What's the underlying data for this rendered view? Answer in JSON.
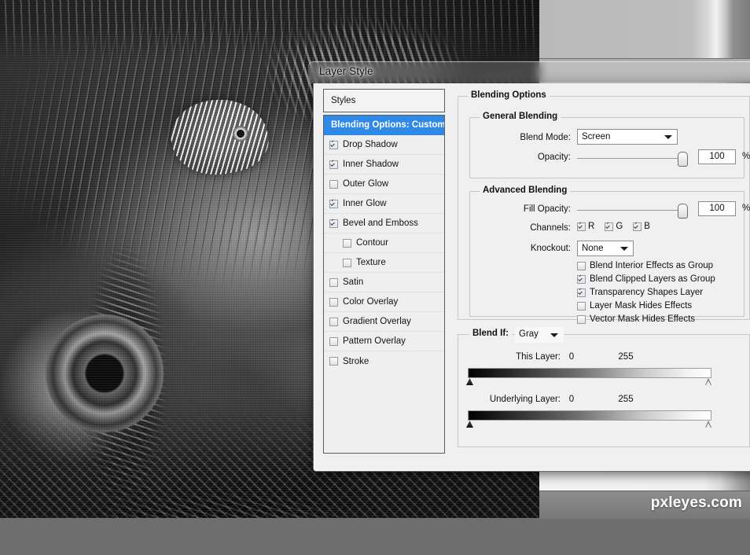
{
  "window": {
    "title": "Layer Style"
  },
  "styles_panel": {
    "header": "Styles",
    "items": [
      {
        "label": "Blending Options: Custom",
        "selected": true,
        "checkbox": null,
        "sub": false
      },
      {
        "label": "Drop Shadow",
        "selected": false,
        "checkbox": true,
        "sub": false
      },
      {
        "label": "Inner Shadow",
        "selected": false,
        "checkbox": true,
        "sub": false
      },
      {
        "label": "Outer Glow",
        "selected": false,
        "checkbox": false,
        "sub": false
      },
      {
        "label": "Inner Glow",
        "selected": false,
        "checkbox": true,
        "sub": false
      },
      {
        "label": "Bevel and Emboss",
        "selected": false,
        "checkbox": true,
        "sub": false
      },
      {
        "label": "Contour",
        "selected": false,
        "checkbox": false,
        "sub": true
      },
      {
        "label": "Texture",
        "selected": false,
        "checkbox": false,
        "sub": true
      },
      {
        "label": "Satin",
        "selected": false,
        "checkbox": false,
        "sub": false
      },
      {
        "label": "Color Overlay",
        "selected": false,
        "checkbox": false,
        "sub": false
      },
      {
        "label": "Gradient Overlay",
        "selected": false,
        "checkbox": false,
        "sub": false
      },
      {
        "label": "Pattern Overlay",
        "selected": false,
        "checkbox": false,
        "sub": false
      },
      {
        "label": "Stroke",
        "selected": false,
        "checkbox": false,
        "sub": false
      }
    ]
  },
  "blending_options": {
    "group_label": "Blending Options",
    "general": {
      "group_label": "General Blending",
      "blend_mode_label": "Blend Mode:",
      "blend_mode_value": "Screen",
      "opacity_label": "Opacity:",
      "opacity_value": "100",
      "opacity_unit": "%"
    },
    "advanced": {
      "group_label": "Advanced Blending",
      "fill_opacity_label": "Fill Opacity:",
      "fill_opacity_value": "100",
      "fill_opacity_unit": "%",
      "channels_label": "Channels:",
      "channels": [
        {
          "label": "R",
          "checked": true
        },
        {
          "label": "G",
          "checked": true
        },
        {
          "label": "B",
          "checked": true
        }
      ],
      "knockout_label": "Knockout:",
      "knockout_value": "None",
      "checkboxes": [
        {
          "label": "Blend Interior Effects as Group",
          "checked": false
        },
        {
          "label": "Blend Clipped Layers as Group",
          "checked": true
        },
        {
          "label": "Transparency Shapes Layer",
          "checked": true
        },
        {
          "label": "Layer Mask Hides Effects",
          "checked": false
        },
        {
          "label": "Vector Mask Hides Effects",
          "checked": false
        }
      ]
    },
    "blend_if": {
      "label": "Blend If:",
      "channel_value": "Gray",
      "sliders": [
        {
          "label": "This Layer:",
          "min": "0",
          "max": "255"
        },
        {
          "label": "Underlying Layer:",
          "min": "0",
          "max": "255"
        }
      ]
    }
  },
  "watermark": {
    "text": "pxleyes.com"
  },
  "colors": {
    "selection_blue": "#2e8ae6",
    "dialog_face": "#f0f0f0",
    "group_border": "#c8c8c8",
    "text": "#111111"
  }
}
